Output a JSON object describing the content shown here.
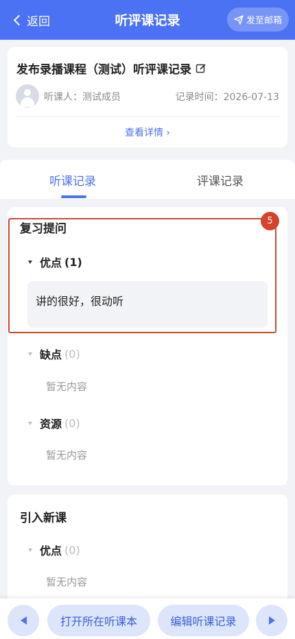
{
  "header": {
    "back_label": "返回",
    "title": "听评课记录",
    "send_mail_label": "发至邮箱"
  },
  "info": {
    "course_title": "发布录播课程（测试）听评课记录",
    "listener_label": "听课人：",
    "listener_name": "测试成员",
    "record_time_label": "记录时间：",
    "record_time": "2026-07-13",
    "detail_link": "查看详情"
  },
  "tabs": [
    {
      "label": "听课记录",
      "active": true
    },
    {
      "label": "评课记录",
      "active": false
    }
  ],
  "sections": [
    {
      "title": "复习提问",
      "groups": [
        {
          "label": "优点",
          "count": "(1)",
          "items": [
            "讲的很好，很动听"
          ]
        },
        {
          "label": "缺点",
          "count": "(0)",
          "empty": "暂无内容"
        },
        {
          "label": "资源",
          "count": "(0)",
          "empty": "暂无内容"
        }
      ]
    },
    {
      "title": "引入新课",
      "groups": [
        {
          "label": "优点",
          "count": "(0)",
          "empty": "暂无内容"
        }
      ]
    }
  ],
  "highlight_badge": "5",
  "bottom": {
    "open_notebook": "打开所在听课本",
    "edit_record": "编辑听课记录"
  },
  "colors": {
    "primary": "#4b72f3",
    "highlight": "#d5442a",
    "background": "#f2f3f6"
  }
}
